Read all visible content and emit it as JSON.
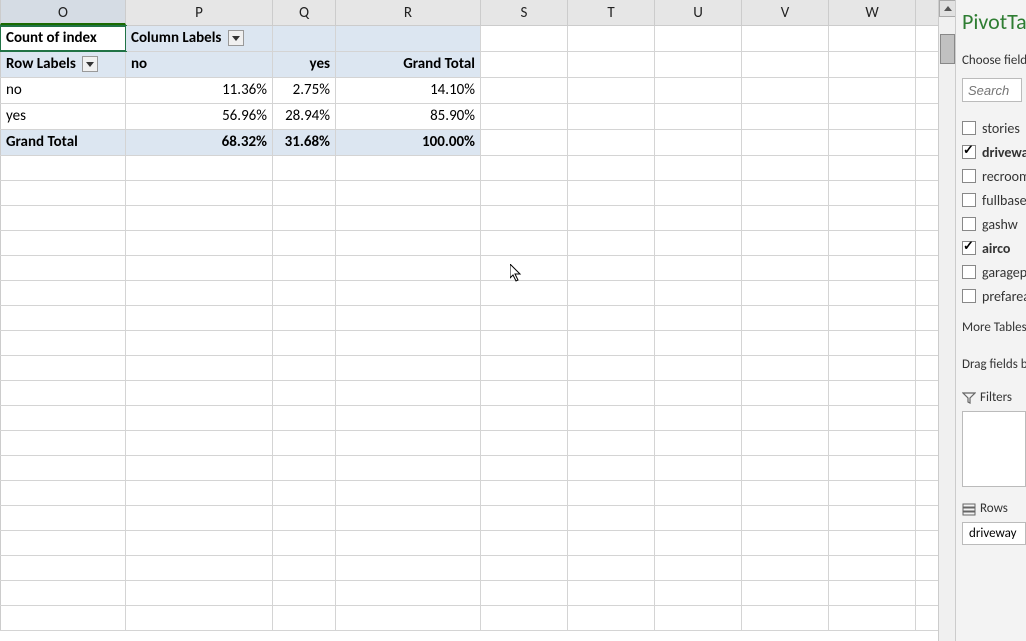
{
  "columns": [
    "O",
    "P",
    "Q",
    "R",
    "S",
    "T",
    "U",
    "V",
    "W"
  ],
  "pivot": {
    "top_left": "Count of index",
    "col_labels_text": "Column Labels",
    "row_labels_text": "Row Labels",
    "grand_total": "Grand Total",
    "col_headers": [
      "no",
      "yes"
    ],
    "rows": [
      {
        "label": "no",
        "no": "11.36%",
        "yes": "2.75%",
        "total": "14.10%"
      },
      {
        "label": "yes",
        "no": "56.96%",
        "yes": "28.94%",
        "total": "85.90%"
      }
    ],
    "totals": {
      "no": "68.32%",
      "yes": "31.68%",
      "total": "100.00%"
    }
  },
  "pane": {
    "title": "PivotTable Fields",
    "choose": "Choose fields to add to report:",
    "search_placeholder": "Search",
    "fields": [
      {
        "id": "stories",
        "label": "stories",
        "checked": false
      },
      {
        "id": "driveway",
        "label": "driveway",
        "checked": true
      },
      {
        "id": "recroom",
        "label": "recroom",
        "checked": false
      },
      {
        "id": "fullbase",
        "label": "fullbase",
        "checked": false
      },
      {
        "id": "gashw",
        "label": "gashw",
        "checked": false
      },
      {
        "id": "airco",
        "label": "airco",
        "checked": true
      },
      {
        "id": "garagepl",
        "label": "garagepl",
        "checked": false
      },
      {
        "id": "prefarea",
        "label": "prefarea",
        "checked": false
      }
    ],
    "more_tables": "More Tables...",
    "drag": "Drag fields between areas below:",
    "filters_label": "Filters",
    "rows_label": "Rows",
    "rows_chip": "driveway"
  }
}
